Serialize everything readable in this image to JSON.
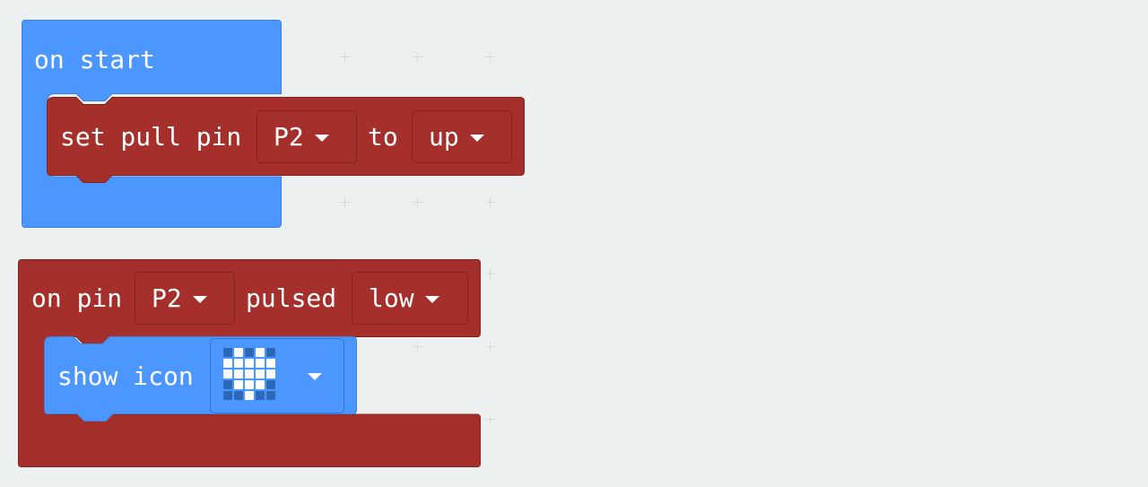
{
  "on_start": {
    "label": "on start"
  },
  "set_pull": {
    "label": "set pull pin",
    "pin": "P2",
    "to_label": "to",
    "pull": "up"
  },
  "on_pin_pulsed": {
    "label_on": "on pin",
    "pin": "P2",
    "label_pulsed": "pulsed",
    "pulse": "low"
  },
  "show_icon": {
    "label": "show icon",
    "icon": "heart-icon",
    "leds": [
      [
        0,
        1,
        0,
        1,
        0
      ],
      [
        1,
        1,
        1,
        1,
        1
      ],
      [
        1,
        1,
        1,
        1,
        1
      ],
      [
        0,
        1,
        1,
        1,
        0
      ],
      [
        0,
        0,
        1,
        0,
        0
      ]
    ]
  },
  "colors": {
    "workspace_bg": "#ecf0f1",
    "basic_blue": "#4c97ff",
    "pins_red": "#a5302b"
  }
}
